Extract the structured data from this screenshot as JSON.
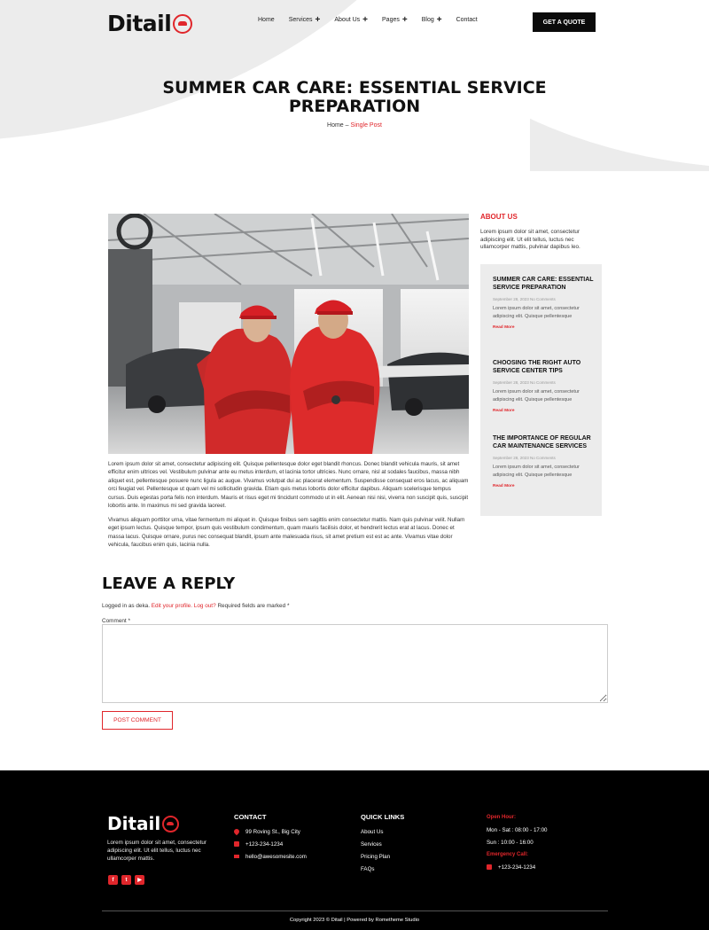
{
  "header": {
    "brand": "Ditail",
    "nav": [
      {
        "label": "Home",
        "plus": false
      },
      {
        "label": "Services",
        "plus": true
      },
      {
        "label": "About Us",
        "plus": true
      },
      {
        "label": "Pages",
        "plus": true
      },
      {
        "label": "Blog",
        "plus": true
      },
      {
        "label": "Contact",
        "plus": false
      }
    ],
    "cta": "GET A QUOTE"
  },
  "hero": {
    "title_line1": "SUMMER CAR CARE: ESSENTIAL SERVICE",
    "title_line2": "PREPARATION",
    "crumb_home": "Home",
    "crumb_sep": "–",
    "crumb_current": "Single Post"
  },
  "post": {
    "paragraph1": "Lorem ipsum dolor sit amet, consectetur adipiscing elit. Quisque pellentesque dolor eget blandit rhoncus. Donec blandit vehicula mauris, sit amet efficitur enim ultrices vel. Vestibulum pulvinar ante eu metus interdum, et lacinia tortor ultricies. Nunc ornare, nisl at sodales faucibus, massa nibh aliquet est, pellentesque posuere nunc ligula ac augue. Vivamus volutpat dui ac placerat elementum. Suspendisse consequat eros lacus, ac aliquam orci feugiat vel. Pellentesque ut quam vel mi sollicitudin gravida. Etiam quis metus lobortis dolor efficitur dapibus. Aliquam scelerisque tempus cursus. Duis egestas porta felis non interdum. Mauris et risus eget mi tincidunt commodo ut in elit. Aenean nisi nisi, viverra non suscipit quis, suscipit lobortis ante. In maximus mi sed gravida laoreet.",
    "paragraph2": "Vivamus aliquam porttitor urna, vitae fermentum mi aliquet in. Quisque finibus sem sagittis enim consectetur mattis. Nam quis pulvinar velit. Nullam eget ipsum lectus. Quisque tempor, ipsum quis vestibulum condimentum, quam mauris facilisis dolor, et hendrerit lectus erat at lacus. Donec et massa lacus. Quisque ornare, purus nec consequat blandit, ipsum ante malesuada risus, sit amet pretium est est ac ante. Vivamus vitae dolor vehicula, faucibus enim quis, lacinia nulla."
  },
  "sidebar": {
    "about_title": "ABOUT US",
    "about_text": "Lorem ipsum dolor sit amet, consectetur adipiscing elit. Ut elit tellus, luctus nec ullamcorper mattis, pulvinar dapibus leo.",
    "recent": [
      {
        "title": "SUMMER CAR CARE: ESSENTIAL SERVICE PREPARATION",
        "meta": "September 28, 2023 No Comments",
        "excerpt": "Lorem ipsum dolor sit amet, consectetur adipiscing elit. Quisque pellentesque",
        "more": "Read More"
      },
      {
        "title": "CHOOSING THE RIGHT AUTO SERVICE CENTER TIPS",
        "meta": "September 28, 2023 No Comments",
        "excerpt": "Lorem ipsum dolor sit amet, consectetur adipiscing elit. Quisque pellentesque",
        "more": "Read More"
      },
      {
        "title": "THE IMPORTANCE OF REGULAR CAR MAINTENANCE SERVICES",
        "meta": "September 28, 2023 No Comments",
        "excerpt": "Lorem ipsum dolor sit amet, consectetur adipiscing elit. Quisque pellentesque",
        "more": "Read More"
      }
    ]
  },
  "reply": {
    "title": "LEAVE A REPLY",
    "logged_prefix": "Logged in as deka.",
    "edit_link": "Edit your profile.",
    "logout_link": "Log out?",
    "required_note": "Required fields are marked *",
    "comment_label": "Comment *",
    "comment_value": "",
    "submit": "POST COMMENT"
  },
  "footer": {
    "brand": "Ditail",
    "about": "Lorem ipsum dolor sit amet, consectetur adipiscing elit. Ut elit tellus, luctus nec ullamcorper mattis.",
    "social": [
      {
        "icon": "facebook-icon",
        "glyph": "f"
      },
      {
        "icon": "twitter-icon",
        "glyph": "t"
      },
      {
        "icon": "youtube-icon",
        "glyph": "▶"
      }
    ],
    "contact_title": "CONTACT",
    "address": "99 Roving St., Big City",
    "phone": "+123-234-1234",
    "email": "hello@awesomesite.com",
    "links_title": "QUICK LINKS",
    "links": [
      "About Us",
      "Services",
      "Pricing Plan",
      "FAQs"
    ],
    "open_title": "Open Hour:",
    "hours_weekday": "Mon - Sat : 08:00 - 17:00",
    "hours_sunday": "Sun : 10:00 - 16:00",
    "emergency_title": "Emergency Call:",
    "emergency_phone": "+123-234-1234",
    "copyright": "Copyright 2023 © Ditail | Powered by Rometheme Studio"
  },
  "colors": {
    "accent": "#e0262b",
    "dark": "#0b0b0b",
    "light_grey": "#ececec"
  }
}
